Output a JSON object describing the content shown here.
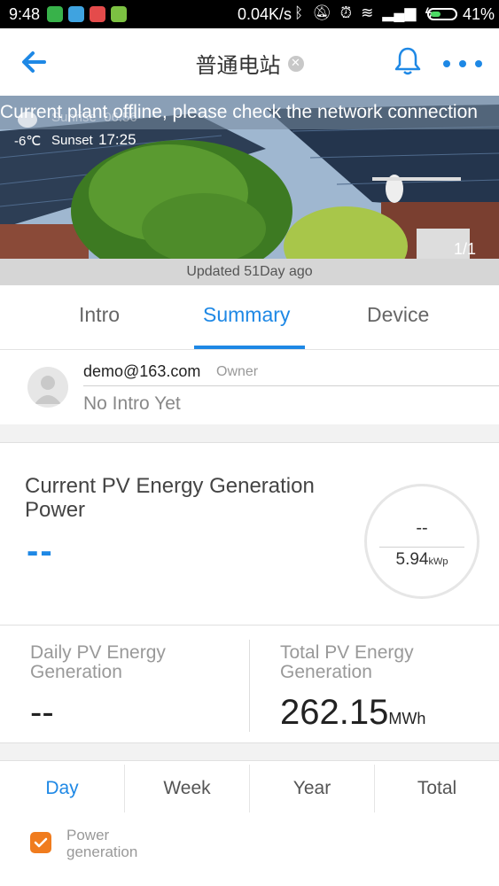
{
  "status_bar": {
    "time": "9:48",
    "network_speed": "0.04K/s",
    "battery_percent": "41%",
    "battery_level": 0.41
  },
  "nav": {
    "title": "普通电站",
    "colors": {
      "accent": "#1e88e5"
    }
  },
  "hero": {
    "offline_message": "Current plant offline, please check the network connection",
    "sunrise_label": "Sunrise",
    "sunrise_time": "06:56",
    "temperature": "-6℃",
    "sunset_label": "Sunset",
    "sunset_time": "17:25",
    "page_indicator": "1/1"
  },
  "updated": "Updated 51Day ago",
  "tabs": [
    {
      "label": "Intro",
      "active": false
    },
    {
      "label": "Summary",
      "active": true
    },
    {
      "label": "Device",
      "active": false
    }
  ],
  "owner": {
    "email": "demo@163.com",
    "role": "Owner",
    "intro": "No Intro Yet"
  },
  "current_power": {
    "label": "Current PV Energy Generation Power",
    "value": "--",
    "gauge_value": "--",
    "capacity": "5.94",
    "capacity_unit": "kWp"
  },
  "energy": {
    "daily": {
      "label": "Daily PV Energy Generation",
      "value": "--"
    },
    "total": {
      "label": "Total PV Energy Generation",
      "value": "262.15",
      "unit": "MWh"
    }
  },
  "period_tabs": [
    {
      "label": "Day",
      "active": true
    },
    {
      "label": "Week",
      "active": false
    },
    {
      "label": "Year",
      "active": false
    },
    {
      "label": "Total",
      "active": false
    }
  ],
  "legend": {
    "label": "Power generation",
    "checked": true,
    "color": "#f07c1e"
  }
}
